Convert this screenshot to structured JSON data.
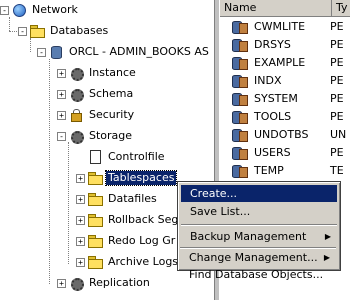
{
  "tree": {
    "network": "Network",
    "databases": "Databases",
    "orcl": "ORCL - ADMIN_BOOKS AS",
    "instance": "Instance",
    "schema": "Schema",
    "security": "Security",
    "storage": "Storage",
    "controlfile": "Controlfile",
    "tablespaces": "Tablespaces",
    "datafiles": "Datafiles",
    "rollback": "Rollback Seg",
    "redo": "Redo Log Gr",
    "archive": "Archive Logs",
    "replication": "Replication"
  },
  "table": {
    "columns": [
      "Name",
      "Ty"
    ],
    "rows": [
      {
        "name": "CWMLITE",
        "type": "PE"
      },
      {
        "name": "DRSYS",
        "type": "PE"
      },
      {
        "name": "EXAMPLE",
        "type": "PE"
      },
      {
        "name": "INDX",
        "type": "PE"
      },
      {
        "name": "SYSTEM",
        "type": "PE"
      },
      {
        "name": "TOOLS",
        "type": "PE"
      },
      {
        "name": "UNDOTBS",
        "type": "UN"
      },
      {
        "name": "USERS",
        "type": "PE"
      },
      {
        "name": "TEMP",
        "type": "TE"
      }
    ]
  },
  "context_menu": {
    "create": "Create...",
    "save_list": "Save List...",
    "backup": "Backup Management",
    "change": "Change Management...",
    "find": "Find Database Objects..."
  },
  "colors": {
    "selection": "#0a246a",
    "menu_bg": "#d4d0c8"
  }
}
